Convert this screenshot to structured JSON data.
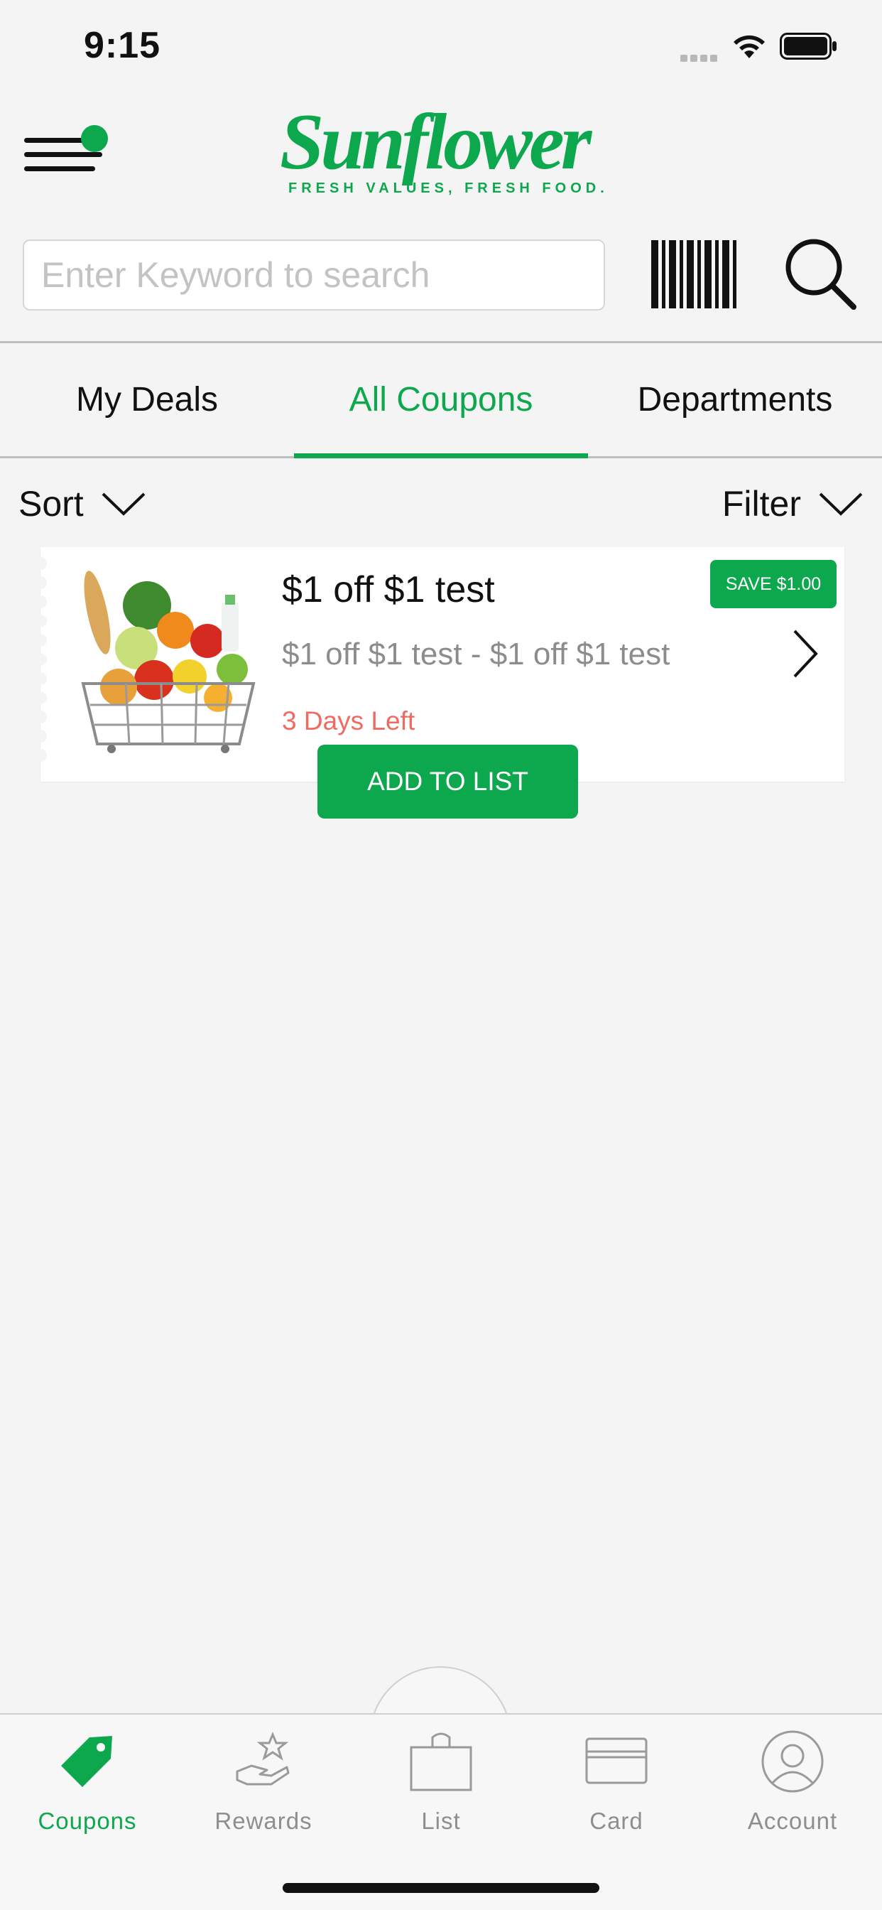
{
  "status_bar": {
    "time": "9:15"
  },
  "header": {
    "logo_text": "Sunflower",
    "logo_tagline": "FRESH VALUES, FRESH FOOD.",
    "menu_icon": "hamburger-menu-icon",
    "notification_color": "#0da84d"
  },
  "search": {
    "placeholder": "Enter Keyword to search",
    "value": "",
    "barcode_icon": "barcode-icon",
    "search_icon": "search-icon"
  },
  "tabs": [
    {
      "label": "My Deals",
      "active": false
    },
    {
      "label": "All Coupons",
      "active": true
    },
    {
      "label": "Departments",
      "active": false
    }
  ],
  "sort_label": "Sort",
  "filter_label": "Filter",
  "coupons": [
    {
      "title": "$1 off $1 test",
      "description": "$1 off $1 test - $1 off $1 test",
      "days_left": "3 Days Left",
      "save_badge": "SAVE $1.00",
      "add_button": "ADD TO LIST",
      "image": "grocery-basket-image"
    }
  ],
  "bottom_nav": [
    {
      "label": "Coupons",
      "icon": "tag-icon",
      "active": true
    },
    {
      "label": "Rewards",
      "icon": "rewards-hand-star-icon",
      "active": false
    },
    {
      "label": "List",
      "icon": "bag-icon",
      "active": false
    },
    {
      "label": "Card",
      "icon": "card-icon",
      "active": false
    },
    {
      "label": "Account",
      "icon": "account-icon",
      "active": false
    }
  ],
  "colors": {
    "accent": "#0da84d",
    "days_left": "#ef6b61",
    "background": "#f4f4f4"
  }
}
